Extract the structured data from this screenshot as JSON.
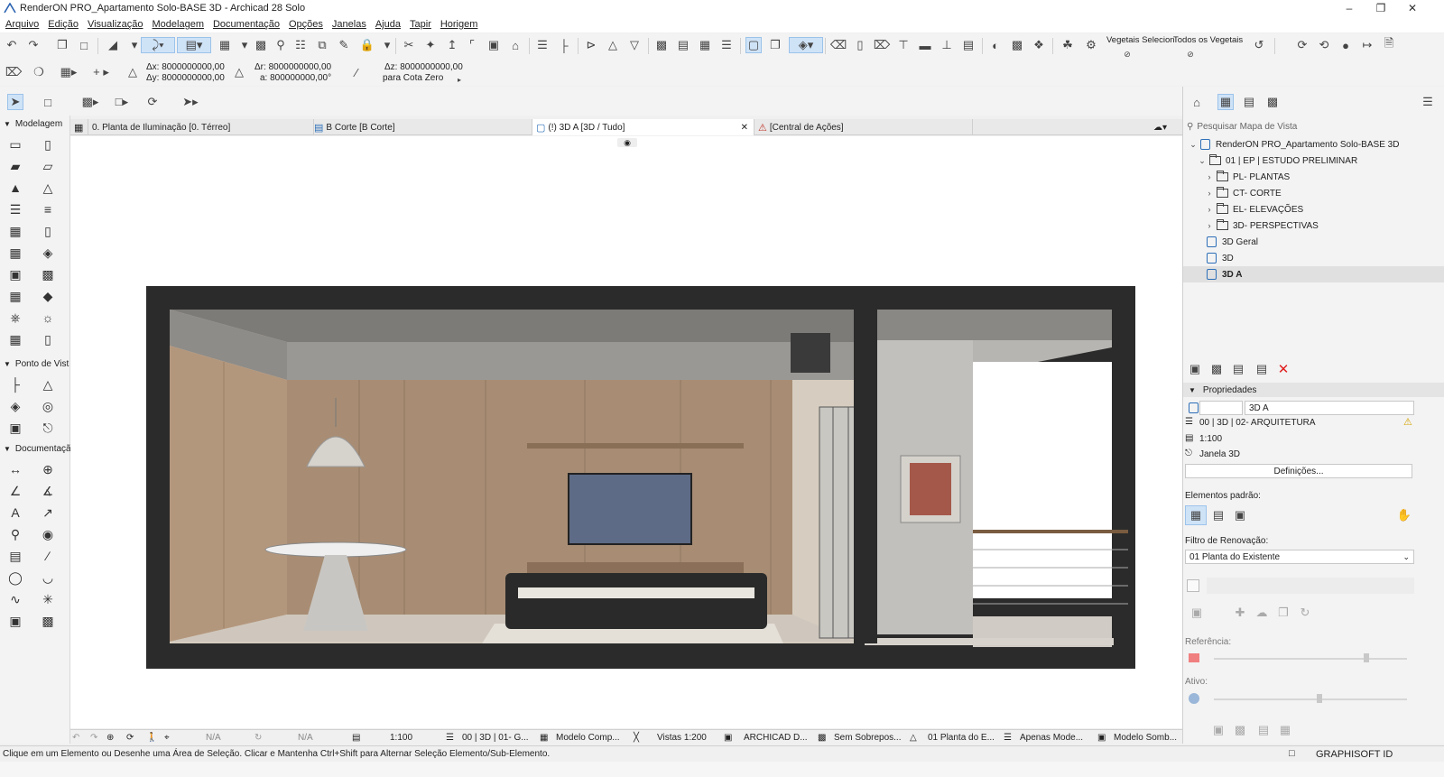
{
  "window": {
    "title": "RenderON PRO_Apartamento Solo-BASE 3D - Archicad 28 Solo"
  },
  "menu": [
    "Arquivo",
    "Edição",
    "Visualização",
    "Modelagem",
    "Documentação",
    "Opções",
    "Janelas",
    "Ajuda",
    "Tapir",
    "Horigem"
  ],
  "toolbar": {
    "filter_label_1": "Vegetais Selecion",
    "filter_label_2": "Todos os Vegetais"
  },
  "infobox": {
    "dx": "Δx: 8000000000,00",
    "dy": "Δy: 8000000000,00",
    "dr": "Δr: 8000000000,00",
    "da": "a: 800000000,00°",
    "dz": "Δz: 8000000000,00",
    "zero": "para Cota Zero"
  },
  "toolbox": {
    "sections": [
      "Modelagem",
      "Ponto de Vist",
      "Documentaçã"
    ]
  },
  "tabs": [
    {
      "label": "0. Planta de Iluminação [0. Térreo]"
    },
    {
      "label": "B Corte [B Corte]"
    },
    {
      "label": "(!) 3D A [3D / Tudo]"
    },
    {
      "label": "[Central de Ações]"
    }
  ],
  "navigator": {
    "search_placeholder": "Pesquisar Mapa de Vista",
    "items": [
      {
        "label": "RenderON PRO_Apartamento Solo-BASE 3D"
      },
      {
        "label": "01 | EP | ESTUDO PRELIMINAR"
      },
      {
        "label": "PL- PLANTAS"
      },
      {
        "label": "CT- CORTE"
      },
      {
        "label": "EL- ELEVAÇÕES"
      },
      {
        "label": "3D- PERSPECTIVAS"
      },
      {
        "label": "3D Geral"
      },
      {
        "label": "3D"
      },
      {
        "label": "3D A"
      }
    ]
  },
  "properties": {
    "header": "Propriedades",
    "name_value": "3D A",
    "layer": "00 | 3D | 02- ARQUITETURA",
    "scale": "1:100",
    "window_type": "Janela 3D",
    "settings_button": "Definições...",
    "default_elements": "Elementos padrão:",
    "renovation_filter": "Filtro de Renovação:",
    "renovation_value": "01 Planta do Existente",
    "reference": "Referência:",
    "active": "Ativo:"
  },
  "bottombar": {
    "na1": "N/A",
    "na2": "N/A",
    "scale": "1:100",
    "layer_combo": "00 | 3D | 01- G...",
    "model_view": "Modelo Comp...",
    "views": "Vistas 1:200",
    "archicad": "ARCHICAD D...",
    "overrides": "Sem Sobrepos...",
    "renovation": "01 Planta do E...",
    "only_model": "Apenas Mode...",
    "shaded": "Modelo Somb..."
  },
  "status": {
    "message": "Clique em um Elemento ou Desenhe uma Área de Seleção. Clicar e Mantenha Ctrl+Shift para Alternar Seleção Elemento/Sub-Elemento.",
    "brand": "GRAPHISOFT ID"
  }
}
